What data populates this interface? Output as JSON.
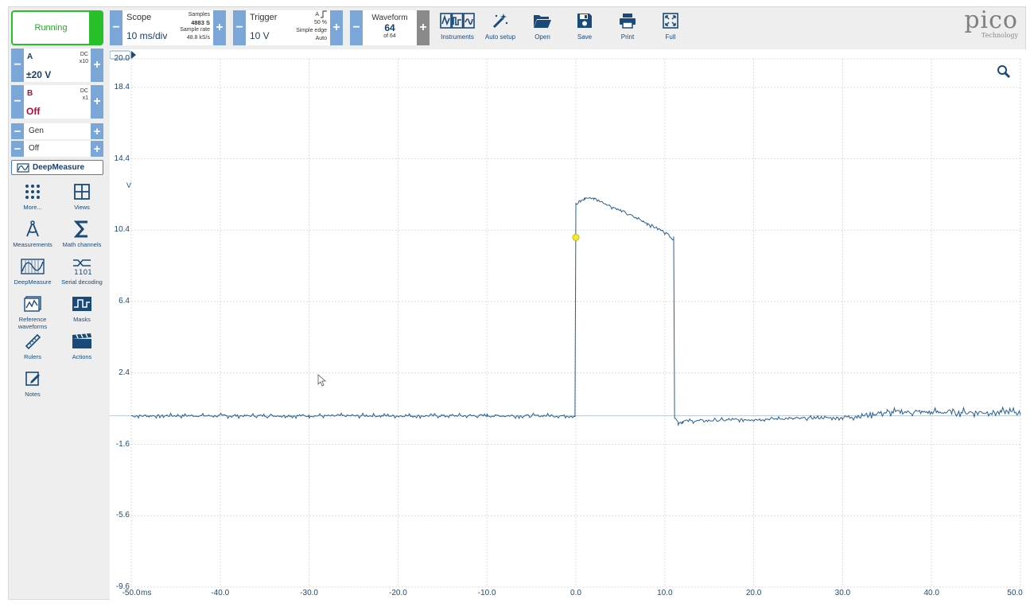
{
  "toolbar": {
    "run_label": "Running",
    "scope": {
      "label": "Scope",
      "value": "10 ms/div",
      "samples_label": "Samples",
      "samples_value": "4883 S",
      "rate_label": "Sample rate",
      "rate_value": "48.8 kS/s"
    },
    "trigger": {
      "label": "Trigger",
      "value": "10 V",
      "channel": "A",
      "level": "50 %",
      "type": "Simple edge",
      "mode": "Auto"
    },
    "waveform": {
      "label": "Waveform",
      "value": "64",
      "of": "of 64"
    },
    "tools": [
      {
        "name": "instruments",
        "label": "Instruments"
      },
      {
        "name": "auto-setup",
        "label": "Auto setup"
      },
      {
        "name": "open",
        "label": "Open"
      },
      {
        "name": "save",
        "label": "Save"
      },
      {
        "name": "print",
        "label": "Print"
      },
      {
        "name": "full",
        "label": "Full"
      }
    ]
  },
  "logo": {
    "name": "pico",
    "sub": "Technology"
  },
  "channels": {
    "a": {
      "name": "A",
      "coupling": "DC",
      "probe": "x10",
      "range": "±20 V",
      "color": "#1a3f6a"
    },
    "b": {
      "name": "B",
      "coupling": "DC",
      "probe": "x1",
      "range": "Off",
      "color": "#b0103a"
    }
  },
  "gen": {
    "label": "Gen",
    "value": "Off"
  },
  "deepmeasure_button": "DeepMeasure",
  "panel_tools": [
    {
      "name": "more",
      "label": "More..."
    },
    {
      "name": "views",
      "label": "Views"
    },
    {
      "name": "measurements",
      "label": "Measurements"
    },
    {
      "name": "math-channels",
      "label": "Math channels"
    },
    {
      "name": "deepmeasure",
      "label": "DeepMeasure"
    },
    {
      "name": "serial-decoding",
      "label": "Serial decoding"
    },
    {
      "name": "reference-waveforms",
      "label": "Reference waveforms"
    },
    {
      "name": "masks",
      "label": "Masks"
    },
    {
      "name": "rulers",
      "label": "Rulers"
    },
    {
      "name": "actions",
      "label": "Actions"
    },
    {
      "name": "notes",
      "label": "Notes"
    }
  ],
  "axes": {
    "y_unit": "V",
    "y_ticks": [
      "20.0",
      "18.4",
      "14.4",
      "10.4",
      "6.4",
      "2.4",
      "-1.6",
      "-5.6",
      "-9.6"
    ],
    "x_unit": "ms",
    "x_ticks": [
      "-50.0",
      "-40.0",
      "-30.0",
      "-20.0",
      "-10.0",
      "0.0",
      "10.0",
      "20.0",
      "30.0",
      "40.0",
      "50.0"
    ]
  },
  "chart_data": {
    "type": "line",
    "xlabel": "ms",
    "ylabel": "V",
    "ylim": [
      -9.6,
      20.0
    ],
    "xlim": [
      -50,
      50
    ],
    "grid": true,
    "trigger_point": {
      "x": 0.0,
      "y": 10.0
    },
    "series": [
      {
        "color": "#2a5f95",
        "x": [
          -50,
          -30,
          -10,
          -0.1,
          0.0,
          0.5,
          1,
          2,
          5,
          8,
          10,
          11.0,
          11.1,
          11.5,
          12,
          20,
          30,
          35,
          40,
          50
        ],
        "y": [
          0.0,
          0.0,
          0.0,
          0.0,
          11.8,
          12.0,
          12.2,
          12.2,
          11.5,
          10.8,
          10.3,
          9.9,
          0.0,
          -0.4,
          -0.3,
          -0.2,
          -0.1,
          0.2,
          0.2,
          0.2
        ]
      }
    ]
  },
  "colors": {
    "accent": "#7aa6d8",
    "running": "#27c02a",
    "trace": "#2a5f95",
    "text": "#1a4a7a"
  }
}
